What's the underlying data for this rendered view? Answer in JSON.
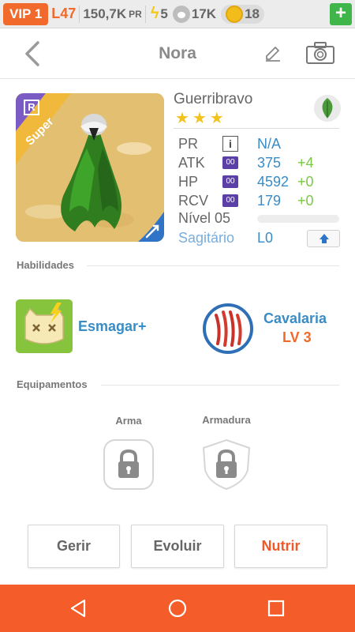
{
  "status": {
    "vip": "VIP 1",
    "level": "L47",
    "pr_value": "150,7K",
    "pr_unit": "PR",
    "energy": "5",
    "food": "17K",
    "coins": "18",
    "add": "+"
  },
  "header": {
    "title": "Nora"
  },
  "pet": {
    "rank_badge": "R",
    "rarity": "Super",
    "species": "Guerribravo",
    "stars": 3,
    "star_glyph": "★",
    "stats": [
      {
        "label": "PR",
        "icon": "i",
        "value": "N/A",
        "bonus": ""
      },
      {
        "label": "ATK",
        "icon": "00",
        "value": "375",
        "bonus": "+4"
      },
      {
        "label": "HP",
        "icon": "00",
        "value": "4592",
        "bonus": "+0"
      },
      {
        "label": "RCV",
        "icon": "00",
        "value": "179",
        "bonus": "+0"
      }
    ],
    "level": "Nível 05",
    "level_progress": 0,
    "sign": "Sagitário",
    "sign_level": "L0",
    "element": "leaf-icon"
  },
  "abilities": {
    "title": "Habilidades",
    "skill": {
      "name": "Esmagar+"
    },
    "trait": {
      "name": "Cavalaria",
      "level": "LV 3"
    }
  },
  "equipment": {
    "title": "Equipamentos",
    "weapon": "Arma",
    "armor": "Armadura"
  },
  "actions": {
    "manage": "Gerir",
    "evolve": "Evoluir",
    "feed": "Nutrir"
  },
  "colors": {
    "accent": "#f45d2a",
    "blue": "#3a8cc6",
    "green": "#7bc846"
  }
}
